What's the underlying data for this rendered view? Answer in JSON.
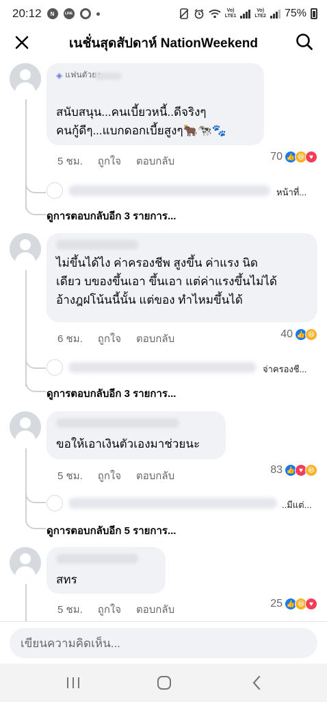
{
  "status_bar": {
    "time": "20:12",
    "app_icons": [
      "N",
      "LINE",
      "chrome"
    ],
    "right_glyphs": [
      "silent",
      "alarm",
      "wifi"
    ],
    "sim1": "Vo) LTE1",
    "sim2": "Vo) LTE2",
    "battery": "75%"
  },
  "header": {
    "title": "เนชั่นสุดสัปดาห์ NationWeekend",
    "close_icon": "close-icon",
    "search_icon": "search-icon"
  },
  "comments": [
    {
      "badge": "แฟนตัวยง",
      "text": "สนับสนุน...คนเบี้ยวหนี้..ดีจริงๆ\nคนกู้ดีๆ...แบกดอกเบี้ยสูงๆ🐂🐄🐾",
      "time": "5 ชม.",
      "like": "ถูกใจ",
      "reply": "ตอบกลับ",
      "reaction_count": "70",
      "reply_snippet": "หน้าที่...",
      "more_replies": "ดูการตอบกลับอีก 3 รายการ..."
    },
    {
      "text": "ไม่ขึ้นได้ไง ค่าครองชีพ สูงขึ้น ค่าแรง นิด\nเดียว บของขึ้นเอา ขึ้นเอา แต่ค่าแรงขึ้นไม่ได้\nอ้างฎฝโน้นนี้นั้น แต่ของ ทำไหมขึ้นได้",
      "time": "6 ชม.",
      "like": "ถูกใจ",
      "reply": "ตอบกลับ",
      "reaction_count": "40",
      "reply_snippet": "จ่าครองชี...",
      "more_replies": "ดูการตอบกลับอีก 3 รายการ..."
    },
    {
      "text": "ขอให้เอาเงินตัวเองมาช่วยนะ",
      "time": "5 ชม.",
      "like": "ถูกใจ",
      "reply": "ตอบกลับ",
      "reaction_count": "83",
      "reply_snippet": "..มีแต่...",
      "more_replies": "ดูการตอบกลับอีก 5 รายการ..."
    },
    {
      "text": "สทร",
      "time": "5 ชม.",
      "like": "ถูกใจ",
      "reply": "ตอบกลับ",
      "reaction_count": "25"
    }
  ],
  "composer": {
    "placeholder": "เขียนความคิดเห็น..."
  },
  "nav": {
    "recents": "recents-icon",
    "home": "home-icon",
    "back": "back-icon"
  }
}
